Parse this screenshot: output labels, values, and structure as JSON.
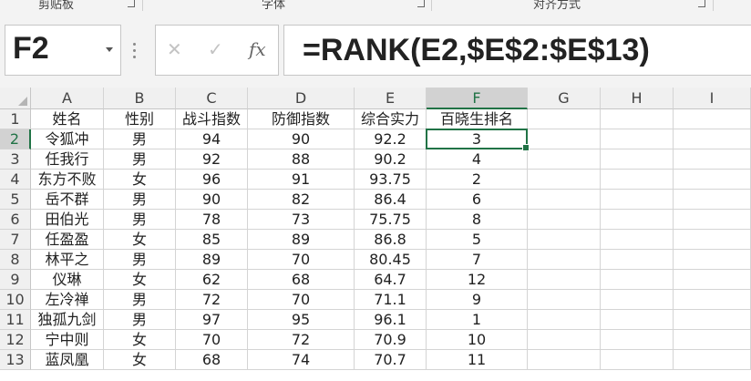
{
  "ribbon": {
    "groups": [
      "剪贴板",
      "字体",
      "对齐方式"
    ]
  },
  "formula_bar": {
    "name_box": "F2",
    "formula": "=RANK(E2,$E$2:$E$13)",
    "cancel_icon": "cancel-x-icon",
    "confirm_icon": "check-icon",
    "function_icon": "fx-icon",
    "fx_label": "fx"
  },
  "grid": {
    "columns": [
      "A",
      "B",
      "C",
      "D",
      "E",
      "F",
      "G",
      "H",
      "I"
    ],
    "rows": [
      [
        "姓名",
        "性别",
        "战斗指数",
        "防御指数",
        "综合实力",
        "百晓生排名"
      ],
      [
        "令狐冲",
        "男",
        "94",
        "90",
        "92.2",
        "3"
      ],
      [
        "任我行",
        "男",
        "92",
        "88",
        "90.2",
        "4"
      ],
      [
        "东方不败",
        "女",
        "96",
        "91",
        "93.75",
        "2"
      ],
      [
        "岳不群",
        "男",
        "90",
        "82",
        "86.4",
        "6"
      ],
      [
        "田伯光",
        "男",
        "78",
        "73",
        "75.75",
        "8"
      ],
      [
        "任盈盈",
        "女",
        "85",
        "89",
        "86.8",
        "5"
      ],
      [
        "林平之",
        "男",
        "89",
        "70",
        "80.45",
        "7"
      ],
      [
        "仪琳",
        "女",
        "62",
        "68",
        "64.7",
        "12"
      ],
      [
        "左冷禅",
        "男",
        "72",
        "70",
        "71.1",
        "9"
      ],
      [
        "独孤九剑",
        "男",
        "97",
        "95",
        "96.1",
        "1"
      ],
      [
        "宁中则",
        "女",
        "70",
        "72",
        "70.9",
        "10"
      ],
      [
        "蓝凤凰",
        "女",
        "68",
        "74",
        "70.7",
        "11"
      ]
    ],
    "row_numbers": [
      "1",
      "2",
      "3",
      "4",
      "5",
      "6",
      "7",
      "8",
      "9",
      "10",
      "11",
      "12",
      "13"
    ],
    "active_cell": "F2",
    "accent_color": "#217346"
  }
}
